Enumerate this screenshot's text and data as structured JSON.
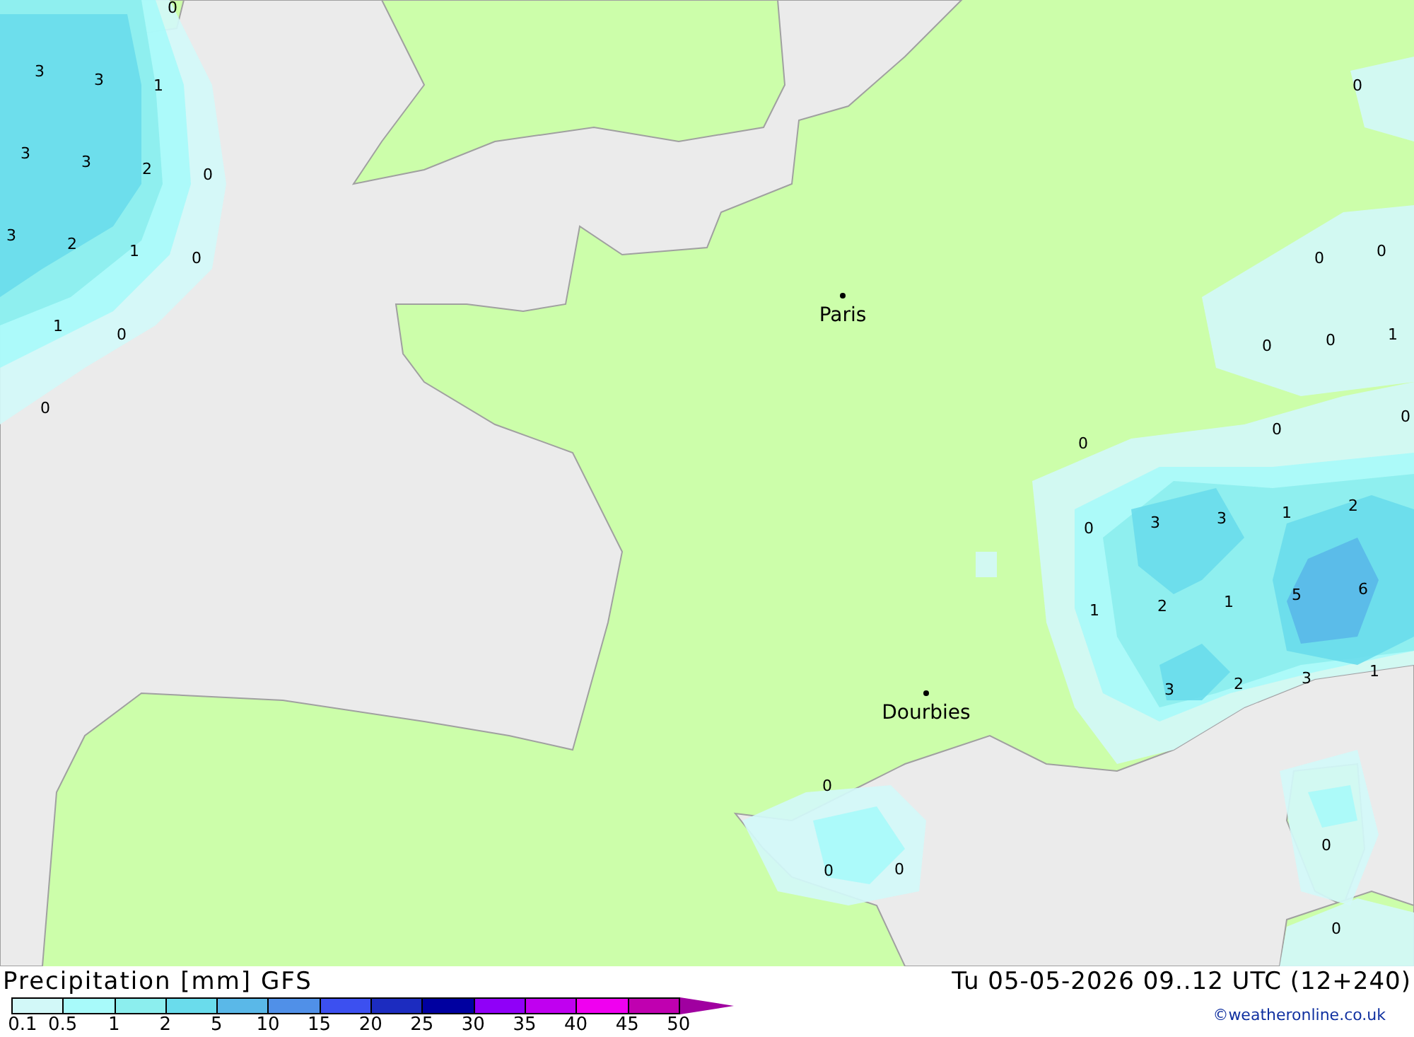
{
  "map": {
    "cities": [
      {
        "name": "Paris"
      },
      {
        "name": "Dourbies"
      }
    ],
    "contour_labels": [
      "0",
      "3",
      "3",
      "1",
      "3",
      "3",
      "2",
      "0",
      "3",
      "2",
      "1",
      "0",
      "1",
      "0",
      "0",
      "0",
      "0",
      "0",
      "0",
      "0",
      "1",
      "0",
      "0",
      "0",
      "0",
      "3",
      "3",
      "1",
      "2",
      "1",
      "2",
      "1",
      "5",
      "6",
      "3",
      "2",
      "3",
      "1",
      "0",
      "0",
      "0",
      "0",
      "0"
    ]
  },
  "footer": {
    "title": "Precipitation [mm] GFS",
    "datetime": "Tu 05-05-2026 09..12 UTC (12+240)",
    "credit": "©weatheronline.co.uk",
    "legend": {
      "bins": [
        {
          "label": "0.1",
          "color": "#d2f8f8"
        },
        {
          "label": "0.5",
          "color": "#a8fafa"
        },
        {
          "label": "1",
          "color": "#8ceeee"
        },
        {
          "label": "2",
          "color": "#6adcec"
        },
        {
          "label": "5",
          "color": "#5ab8e8"
        },
        {
          "label": "10",
          "color": "#5090e8"
        },
        {
          "label": "15",
          "color": "#3c50f0"
        },
        {
          "label": "20",
          "color": "#1c2cc0"
        },
        {
          "label": "25",
          "color": "#0000a0"
        },
        {
          "label": "30",
          "color": "#9000f8"
        },
        {
          "label": "35",
          "color": "#c000f0"
        },
        {
          "label": "40",
          "color": "#f000f0"
        },
        {
          "label": "45",
          "color": "#c000b0"
        }
      ],
      "end_label": "50"
    }
  }
}
